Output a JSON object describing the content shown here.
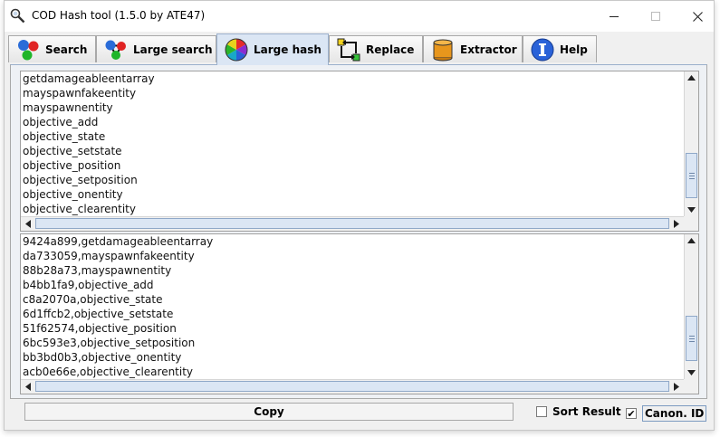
{
  "window": {
    "title": "COD Hash tool (1.5.0 by ATE47)",
    "controls": {
      "minimize": "—",
      "maximize": "☐",
      "close": "✕"
    }
  },
  "tabs": [
    {
      "label": "Search",
      "icon": "colored-dots-icon"
    },
    {
      "label": "Large search",
      "icon": "colored-triangle-dots-icon"
    },
    {
      "label": "Large hash",
      "icon": "color-wheel-icon",
      "active": true
    },
    {
      "label": "Replace",
      "icon": "replace-arrows-icon"
    },
    {
      "label": "Extractor",
      "icon": "barrel-icon"
    },
    {
      "label": "Help",
      "icon": "info-icon"
    }
  ],
  "input_lines": [
    "getdamageableentarray",
    "mayspawnfakeentity",
    "mayspawnentity",
    "objective_add",
    "objective_state",
    "objective_setstate",
    "objective_position",
    "objective_setposition",
    "objective_onentity",
    "objective_clearentity"
  ],
  "output_lines": [
    "9424a899,getdamageableentarray",
    "da733059,mayspawnfakeentity",
    "88b28a73,mayspawnentity",
    "b4bb1fa9,objective_add",
    "c8a2070a,objective_state",
    "6d1ffcb2,objective_setstate",
    "51f62574,objective_position",
    "6bc593e3,objective_setposition",
    "bb3bd0b3,objective_onentity",
    "acb0e66e,objective_clearentity"
  ],
  "footer": {
    "copy_label": "Copy",
    "sort_label": "Sort Result",
    "sort_checked": false,
    "canon_label": "Canon. ID",
    "canon_checked": true,
    "check_mark": "✔"
  },
  "scroll_glyphs": {
    "up": "▲",
    "down": "▼",
    "left": "◀",
    "right": "▶"
  },
  "colors": {
    "active_tab": "#dbe6f4",
    "accent_border": "#9bb0cc"
  }
}
